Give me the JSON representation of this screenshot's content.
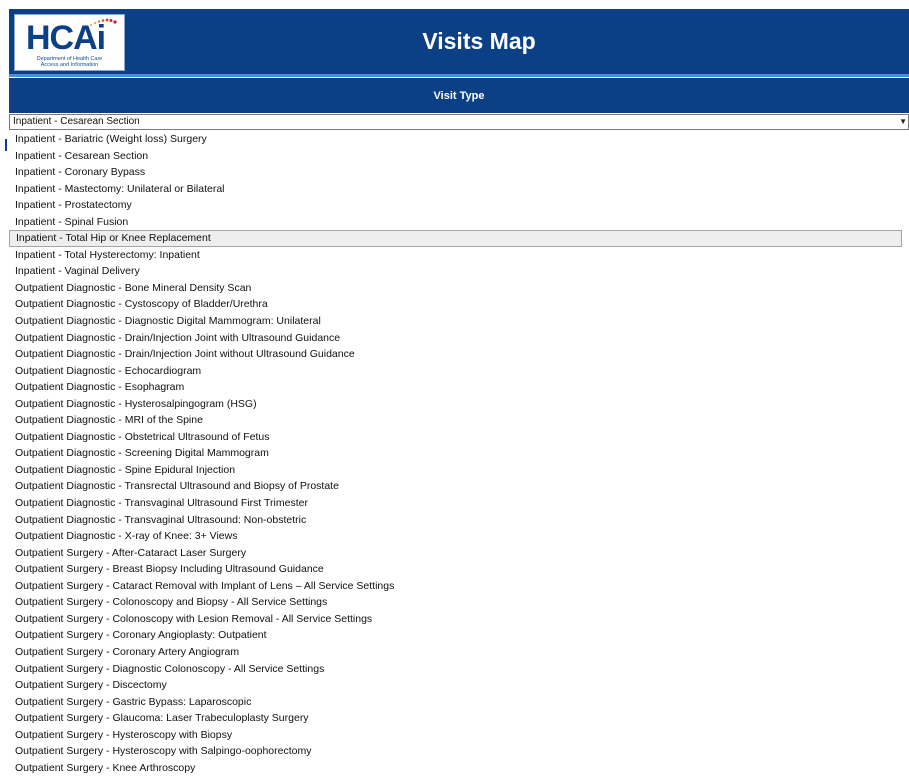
{
  "header": {
    "logo_main": "HCAi",
    "logo_sub_line1": "Department of Health Care",
    "logo_sub_line2": "Access and Information",
    "title": "Visits Map"
  },
  "filter": {
    "label": "Visit Type",
    "selected_value": "Inpatient - Cesarean Section"
  },
  "options": [
    "Inpatient - Bariatric (Weight loss) Surgery",
    "Inpatient - Cesarean Section",
    "Inpatient - Coronary Bypass",
    "Inpatient - Mastectomy: Unilateral or Bilateral",
    "Inpatient - Prostatectomy",
    "Inpatient - Spinal Fusion",
    "Inpatient - Total Hip or Knee Replacement",
    "Inpatient - Total Hysterectomy: Inpatient",
    "Inpatient - Vaginal Delivery",
    "Outpatient Diagnostic - Bone Mineral Density Scan",
    "Outpatient Diagnostic - Cystoscopy of Bladder/Urethra",
    "Outpatient Diagnostic - Diagnostic Digital Mammogram: Unilateral",
    "Outpatient Diagnostic - Drain/Injection Joint with Ultrasound Guidance",
    "Outpatient Diagnostic - Drain/Injection Joint without Ultrasound Guidance",
    "Outpatient Diagnostic - Echocardiogram",
    "Outpatient Diagnostic - Esophagram",
    "Outpatient Diagnostic - Hysterosalpingogram (HSG)",
    "Outpatient Diagnostic - MRI of the Spine",
    "Outpatient Diagnostic - Obstetrical Ultrasound of Fetus",
    "Outpatient Diagnostic - Screening Digital Mammogram",
    "Outpatient Diagnostic - Spine Epidural Injection",
    "Outpatient Diagnostic - Transrectal Ultrasound and Biopsy of Prostate",
    "Outpatient Diagnostic - Transvaginal Ultrasound First Trimester",
    "Outpatient Diagnostic - Transvaginal Ultrasound: Non-obstetric",
    "Outpatient Diagnostic - X-ray of Knee: 3+ Views",
    "Outpatient Surgery - After-Cataract Laser Surgery",
    "Outpatient Surgery - Breast Biopsy Including Ultrasound Guidance",
    "Outpatient Surgery - Cataract Removal with Implant of Lens – All Service Settings",
    "Outpatient Surgery - Colonoscopy and Biopsy - All Service Settings",
    "Outpatient Surgery - Colonoscopy with Lesion Removal - All Service Settings",
    "Outpatient Surgery - Coronary Angioplasty: Outpatient",
    "Outpatient Surgery - Coronary Artery Angiogram",
    "Outpatient Surgery - Diagnostic Colonoscopy - All Service Settings",
    "Outpatient Surgery - Discectomy",
    "Outpatient Surgery - Gastric Bypass: Laparoscopic",
    "Outpatient Surgery - Glaucoma: Laser Trabeculoplasty Surgery",
    "Outpatient Surgery - Hysteroscopy with Biopsy",
    "Outpatient Surgery - Hysteroscopy with Salpingo-oophorectomy",
    "Outpatient Surgery - Knee Arthroscopy"
  ],
  "highlighted_option": "Inpatient - Total Hip or Knee Replacement",
  "colors": {
    "brand_navy": "#0b3f86",
    "accent_blue": "#4a90d9",
    "highlight_bg": "#eeeeee"
  }
}
